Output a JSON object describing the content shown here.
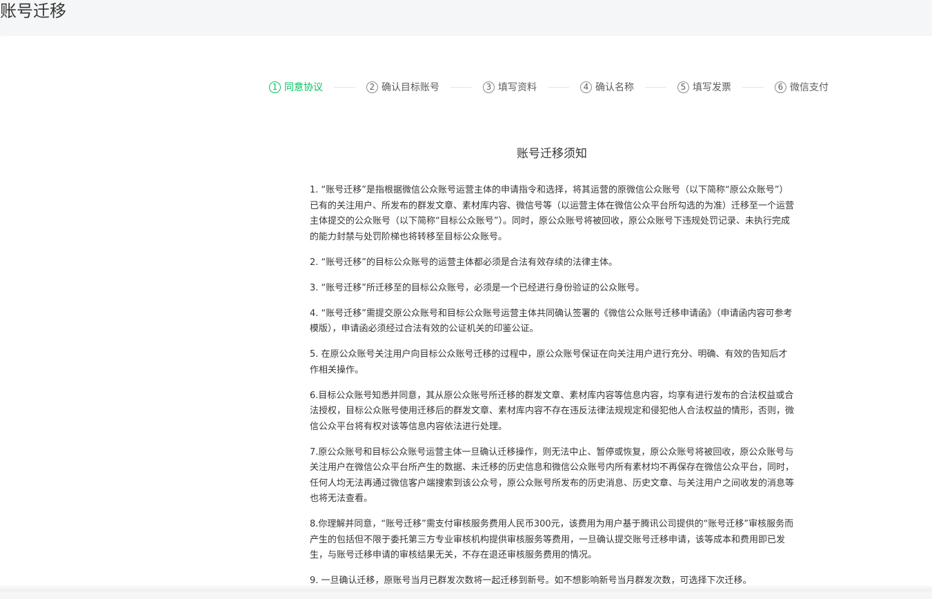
{
  "page": {
    "title": "账号迁移"
  },
  "steps": [
    {
      "num": "1",
      "label": "同意协议",
      "active": true
    },
    {
      "num": "2",
      "label": "确认目标账号",
      "active": false
    },
    {
      "num": "3",
      "label": "填写资料",
      "active": false
    },
    {
      "num": "4",
      "label": "确认名称",
      "active": false
    },
    {
      "num": "5",
      "label": "填写发票",
      "active": false
    },
    {
      "num": "6",
      "label": "微信支付",
      "active": false
    }
  ],
  "doc": {
    "title": "账号迁移须知",
    "paragraphs": [
      "1. “账号迁移”是指根据微信公众账号运营主体的申请指令和选择，将其运营的原微信公众账号（以下简称“原公众账号”）已有的关注用户、所发布的群发文章、素材库内容、微信号等（以运营主体在微信公众平台所勾选的为准）迁移至一个运营主体提交的公众账号（以下简称“目标公众账号”）。同时，原公众账号将被回收，原公众账号下违规处罚记录、未执行完成的能力封禁与处罚阶梯也将转移至目标公众账号。",
      "2. “账号迁移”的目标公众账号的运营主体都必须是合法有效存续的法律主体。",
      "3. “账号迁移”所迁移至的目标公众账号，必须是一个已经进行身份验证的公众账号。",
      "4. “账号迁移”需提交原公众账号和目标公众账号运营主体共同确认签署的《微信公众账号迁移申请函》（申请函内容可参考模版），申请函必须经过合法有效的公证机关的印鉴公证。",
      "5. 在原公众账号关注用户向目标公众账号迁移的过程中，原公众账号保证在向关注用户进行充分、明确、有效的告知后才作相关操作。",
      "6.目标公众账号知悉并同意，其从原公众账号所迁移的群发文章、素材库内容等信息内容，均享有进行发布的合法权益或合法授权，目标公众账号使用迁移后的群发文章、素材库内容不存在违反法律法规规定和侵犯他人合法权益的情形，否则，微信公众平台将有权对该等信息内容依法进行处理。",
      "7.原公众账号和目标公众账号运营主体一旦确认迁移操作，则无法中止、暂停或恢复，原公众账号将被回收，原公众账号与关注用户在微信公众平台所产生的数据、未迁移的历史信息和微信公众账号内所有素材均不再保存在微信公众平台，同时，任何人均无法再通过微信客户端搜索到该公众号，原公众账号所发布的历史消息、历史文章、与关注用户之间收发的消息等也将无法查看。",
      "8.你理解并同意，“账号迁移”需支付审核服务费用人民币300元，该费用为用户基于腾讯公司提供的“账号迁移”审核服务而产生的包括但不限于委托第三方专业审核机构提供审核服务等费用，一旦确认提交账号迁移申请，该等成本和费用即已发生，与账号迁移申请的审核结果无关，不存在退还审核服务费用的情况。",
      "9. 一旦确认迁移，原账号当月已群发次数将一起迁移到新号。如不想影响新号当月群发次数，可选择下次迁移。"
    ]
  }
}
